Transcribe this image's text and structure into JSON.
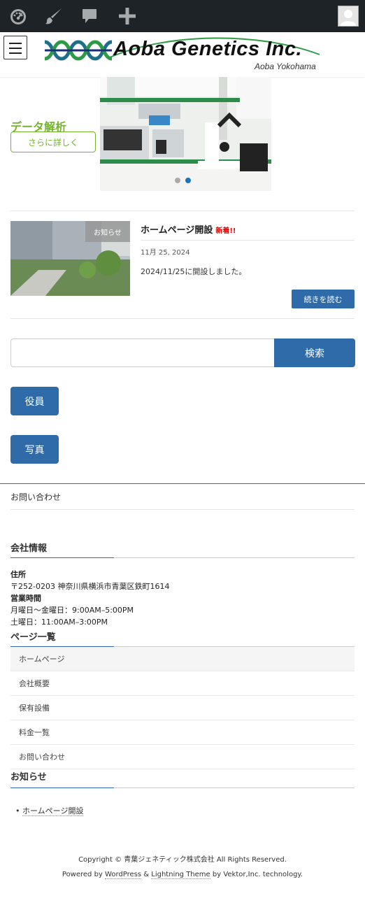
{
  "admin_bar": {
    "icons": [
      "dashboard-icon",
      "customize-brush-icon",
      "comments-icon",
      "add-new-icon"
    ],
    "avatar": "avatar-icon"
  },
  "header": {
    "logo_text": "Aoba Genetics Inc.",
    "logo_sub": "Aoba Yokohama",
    "menu_icon": "hamburger-menu-icon"
  },
  "slider": {
    "title": "データ解析",
    "button_label": "さらに詳しく",
    "active_slide": 2,
    "slide_count": 2
  },
  "post": {
    "badge": "お知らせ",
    "title": "ホームページ開設",
    "new_label": "新着!!",
    "date": "11月 25, 2024",
    "excerpt": "2024/11/25に開設しました。",
    "read_more": "続きを読む"
  },
  "search": {
    "placeholder": "",
    "button_label": "検索"
  },
  "buttons": {
    "officers": "役員",
    "photos": "写真"
  },
  "footer_nav": {
    "contact": "お問い合わせ"
  },
  "company_info": {
    "title": "会社情報",
    "address_label": "住所",
    "address": "〒252-0203 神奈川県横浜市青葉区鉄町1614",
    "hours_label": "営業時間",
    "weekday_hours": "月曜日～金曜日：9:00AM–5:00PM",
    "saturday_hours": "土曜日：11:00AM–3:00PM"
  },
  "page_list": {
    "title": "ページ一覧",
    "items": [
      "ホームページ",
      "会社概要",
      "保有設備",
      "料金一覧",
      "お問い合わせ"
    ]
  },
  "news": {
    "title": "お知らせ",
    "items": [
      "ホームページ開設"
    ]
  },
  "footer": {
    "copyright": "Copyright © 青葉ジェネティック株式会社 All Rights Reserved.",
    "powered_prefix": "Powered by",
    "wordpress": "WordPress",
    "amp": "&",
    "theme": "Lightning Theme",
    "powered_suffix": "by Vektor,Inc. technology."
  },
  "colors": {
    "admin_bar": "#1d2327",
    "primary": "#2e6ba8",
    "slide_green": "#74b52d",
    "new_red": "#e00000"
  }
}
